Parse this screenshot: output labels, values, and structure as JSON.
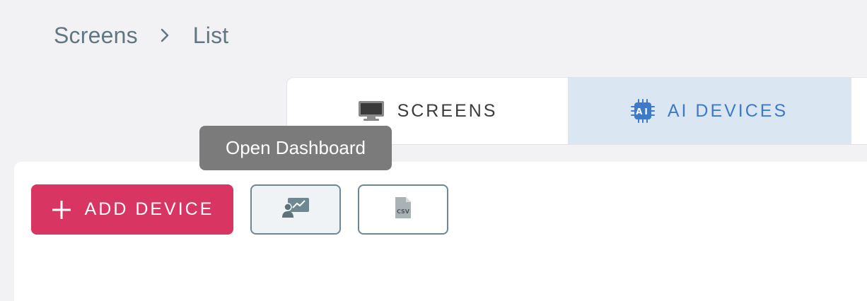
{
  "breadcrumb": {
    "items": [
      "Screens",
      "List"
    ],
    "separator_icon": "chevron-right-icon"
  },
  "tabs": [
    {
      "label": "SCREENS",
      "icon": "monitor-icon",
      "active": false
    },
    {
      "label": "AI DEVICES",
      "icon": "ai-chip-icon",
      "active": true
    }
  ],
  "toolbar": {
    "add_device_label": "ADD DEVICE",
    "add_icon": "plus-icon",
    "dashboard_icon": "dashboard-presenter-icon",
    "csv_icon": "csv-file-icon",
    "csv_icon_text": "CSV"
  },
  "tooltip": {
    "text": "Open Dashboard"
  },
  "colors": {
    "background": "#f2f2f5",
    "breadcrumb_text": "#607782",
    "active_tab_bg": "#dbe6f3",
    "active_tab_text": "#3d7ac7",
    "primary_button": "#d83563",
    "outline_border": "#6f8790",
    "tooltip_bg": "#7b7b7b"
  }
}
